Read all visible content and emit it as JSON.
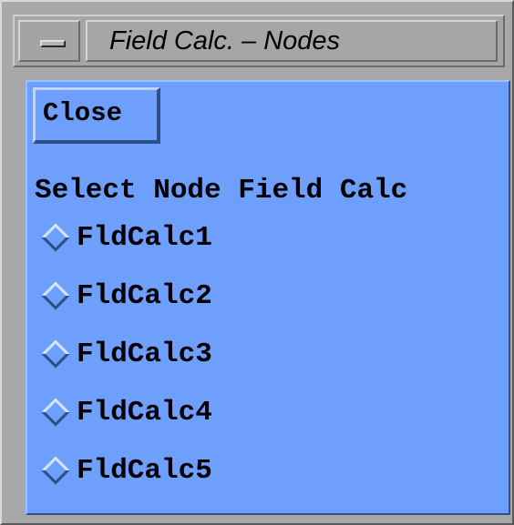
{
  "window": {
    "title": "Field Calc. – Nodes"
  },
  "toolbar": {
    "close_label": "Close"
  },
  "main": {
    "heading": "Select Node Field Calc",
    "options": [
      {
        "label": "FldCalc1"
      },
      {
        "label": "FldCalc2"
      },
      {
        "label": "FldCalc3"
      },
      {
        "label": "FldCalc4"
      },
      {
        "label": "FldCalc5"
      }
    ]
  },
  "colors": {
    "panel_background": "#6f9ffc",
    "frame_gray": "#a8a8a8"
  },
  "icons": {
    "window_menu": "window-menu-icon",
    "radio": "radio-diamond-icon"
  }
}
